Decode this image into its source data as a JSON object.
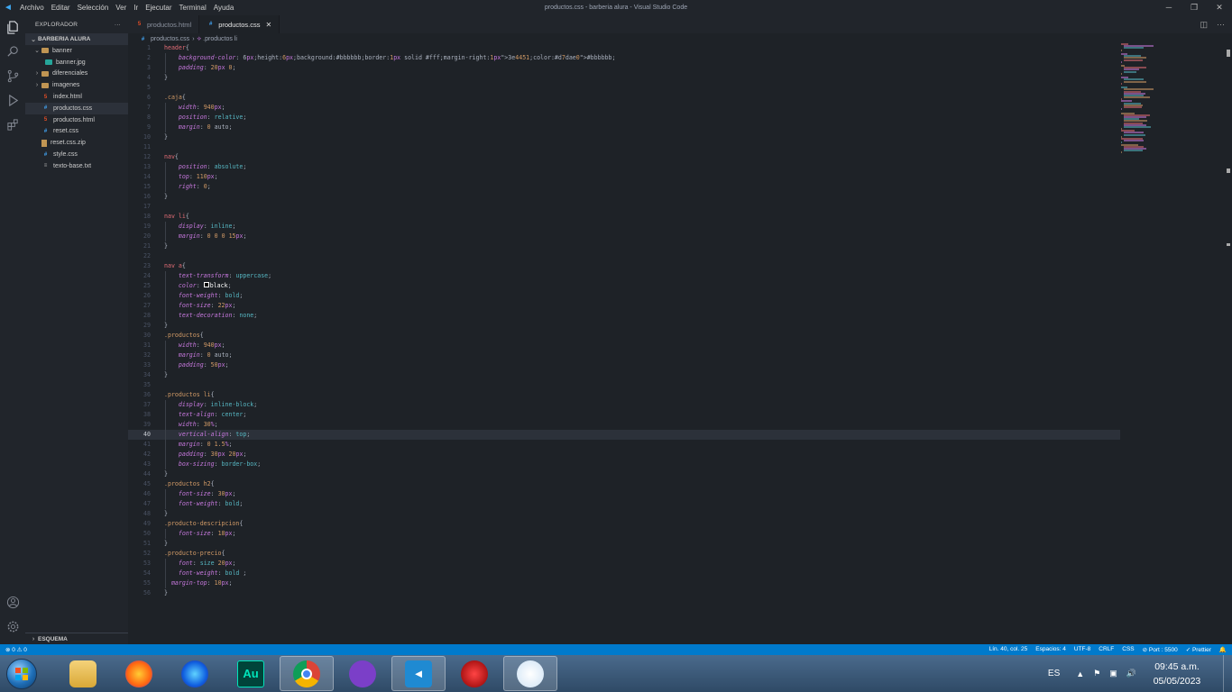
{
  "titlebar": {
    "menu": [
      "Archivo",
      "Editar",
      "Selección",
      "Ver",
      "Ir",
      "Ejecutar",
      "Terminal",
      "Ayuda"
    ],
    "title": "productos.css - barberia alura - Visual Studio Code"
  },
  "explorer": {
    "header": "EXPLORADOR",
    "folder": "BARBERIA ALURA",
    "items": [
      {
        "label": "banner",
        "kind": "folder",
        "expanded": true
      },
      {
        "label": "banner.jpg",
        "kind": "img"
      },
      {
        "label": "diferenciales",
        "kind": "folder"
      },
      {
        "label": "imagenes",
        "kind": "folder"
      },
      {
        "label": "index.html",
        "kind": "html"
      },
      {
        "label": "productos.css",
        "kind": "css",
        "active": true
      },
      {
        "label": "productos.html",
        "kind": "html"
      },
      {
        "label": "reset.css",
        "kind": "css"
      },
      {
        "label": "reset.css.zip",
        "kind": "zip"
      },
      {
        "label": "style.css",
        "kind": "css"
      },
      {
        "label": "texto-base.txt",
        "kind": "txt"
      }
    ],
    "outline": "ESQUEMA"
  },
  "tabs": [
    {
      "label": "productos.html",
      "kind": "html",
      "active": false
    },
    {
      "label": "productos.css",
      "kind": "css",
      "active": true
    }
  ],
  "breadcrumb": {
    "file": "productos.css",
    "symbol": ".productos li"
  },
  "editor": {
    "current_line": 40,
    "lines": [
      "header{",
      "    background-color: #bbbbbb;",
      "    padding: 20px 0;",
      "}",
      "",
      ".caja{",
      "    width: 940px;",
      "    position: relative;",
      "    margin: 0 auto;",
      "}",
      "",
      "nav{",
      "    position: absolute;",
      "    top: 110px;",
      "    right: 0;",
      "}",
      "",
      "nav li{",
      "    display: inline;",
      "    margin: 0 0 0 15px;",
      "}",
      "",
      "nav a{",
      "    text-transform: uppercase;",
      "    color: black;",
      "    font-weight: bold;",
      "    font-size: 22px;",
      "    text-decoration: none;",
      "}",
      ".productos{",
      "    width: 940px;",
      "    margin: 0 auto;",
      "    padding: 50px;",
      "}",
      "",
      ".productos li{",
      "    display: inline-block;",
      "    text-align: center;",
      "    width: 30%;",
      "    vertical-align: top;",
      "    margin: 0 1.5%;",
      "    padding: 30px 20px;",
      "    box-sizing: border-box;",
      "}",
      ".productos h2{",
      "    font-size: 30px;",
      "    font-weight: bold;",
      "}",
      ".producto-descripcion{",
      "    font-size: 18px;",
      "}",
      ".producto-precio{",
      "    font: size 20px;",
      "    font-weight: bold ;",
      "  margin-top: 10px;",
      "}"
    ]
  },
  "statusbar": {
    "problems": "⊗ 0 ⚠ 0",
    "position": "Lín. 40, col. 25",
    "spaces": "Espacios: 4",
    "encoding": "UTF-8",
    "eol": "CRLF",
    "language": "CSS",
    "port": "⊘ Port : 5500",
    "prettier": "✓ Prettier",
    "bell": "🔔"
  },
  "taskbar": {
    "apps": [
      {
        "name": "file-explorer",
        "label": ""
      },
      {
        "name": "firefox",
        "label": ""
      },
      {
        "name": "firefox-developer",
        "label": ""
      },
      {
        "name": "audition",
        "label": "Au"
      },
      {
        "name": "chrome",
        "label": ""
      },
      {
        "name": "app-mask",
        "label": ""
      },
      {
        "name": "vscode",
        "label": ""
      },
      {
        "name": "app-red",
        "label": ""
      },
      {
        "name": "paint",
        "label": ""
      }
    ],
    "lang": "ES",
    "time": "09:45 a.m.",
    "date": "05/05/2023"
  },
  "colors": {
    "selector": "#e06c75",
    "class": "#d19a66",
    "property": "#c678dd",
    "value": "#56b6c2",
    "number": "#d19a66",
    "unit": "#c678dd",
    "accent": "#007acc"
  }
}
